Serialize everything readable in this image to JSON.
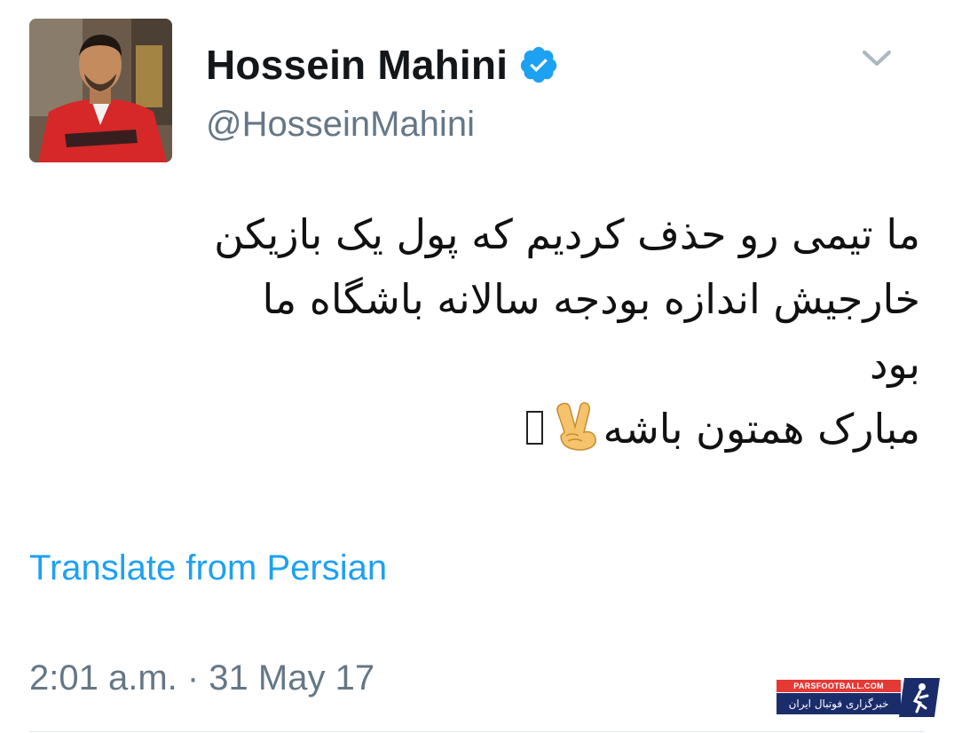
{
  "user": {
    "display_name": "Hossein Mahini",
    "handle": "@HosseinMahini",
    "verified": true,
    "avatar_icon": "profile-photo"
  },
  "tweet": {
    "lines": [
      "ما تیمی رو حذف کردیم که پول یک بازیکن",
      "خارجیش اندازه بودجه سالانه باشگاه ما",
      "بود",
      "مبارک همتون باشه"
    ],
    "emoji_icons": [
      "victory-hand-emoji",
      "missing-glyph-box"
    ]
  },
  "translate_label": "Translate from Persian",
  "timestamp": "2:01 a.m. · 31 May 17",
  "watermark": {
    "site": "PARSFOOTBALL.COM",
    "tagline": "خبرگزاری فوتبال ایران"
  },
  "colors": {
    "link": "#1da1f2",
    "verified": "#1da1f2",
    "secondary_text": "#657786",
    "watermark_red": "#e53935",
    "watermark_navy": "#1b2c6b"
  }
}
